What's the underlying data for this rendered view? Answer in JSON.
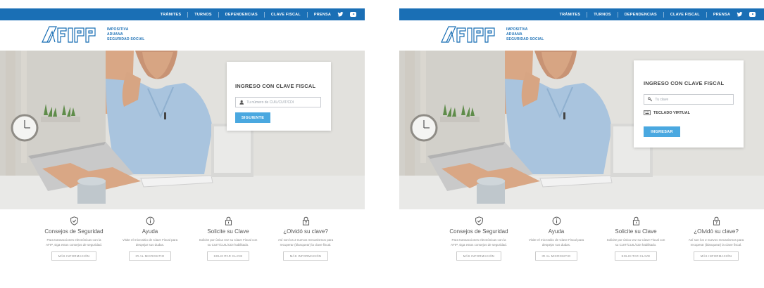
{
  "nav": {
    "tramites": "TRÁMITES",
    "turnos": "TURNOS",
    "dependencias": "DEPENDENCIAS",
    "clave_fiscal": "CLAVE FISCAL",
    "prensa": "PRENSA"
  },
  "brand": {
    "line1": "IMPOSITIVA",
    "line2": "ADUANA",
    "line3": "SEGURIDAD SOCIAL"
  },
  "login_step1": {
    "title": "INGRESO CON CLAVE FISCAL",
    "placeholder": "Tu número de CUIL/CUIT/CDI",
    "button": "SIGUIENTE"
  },
  "login_step2": {
    "title": "INGRESO CON CLAVE FISCAL",
    "placeholder": "Tu clave",
    "keyboard": "TECLADO VIRTUAL",
    "button": "INGRESAR"
  },
  "features": [
    {
      "title": "Consejos de Seguridad",
      "desc": "Para transacciones electrónicas con la AFIP, siga estos consejos de seguridad.",
      "button": "MÁS INFORMACIÓN"
    },
    {
      "title": "Ayuda",
      "desc": "Visite el micrositio de Clave Fiscal para despejar sus dudas.",
      "button": "IR AL MICROSITIO"
    },
    {
      "title": "Solicite su Clave",
      "desc": "Solicite por única vez su Clave Fiscal con su CUIT/CUIL/CDI habilitado.",
      "button": "SOLICITAR CLAVE"
    },
    {
      "title": "¿Olvidó su clave?",
      "desc": "Así son los 2 nuevos mecanismos para recuperar (blanquear) la clave fiscal.",
      "button": "MÁS INFORMACIÓN"
    }
  ],
  "colors": {
    "brand_blue": "#1a6fb5",
    "button_blue": "#4aa8e0",
    "shirt_blue": "#a9c4de"
  },
  "icons": [
    "shield-icon",
    "info-icon",
    "lock-icon",
    "lock-question-icon",
    "user-icon",
    "key-icon",
    "keyboard-icon",
    "twitter-icon",
    "youtube-icon"
  ]
}
